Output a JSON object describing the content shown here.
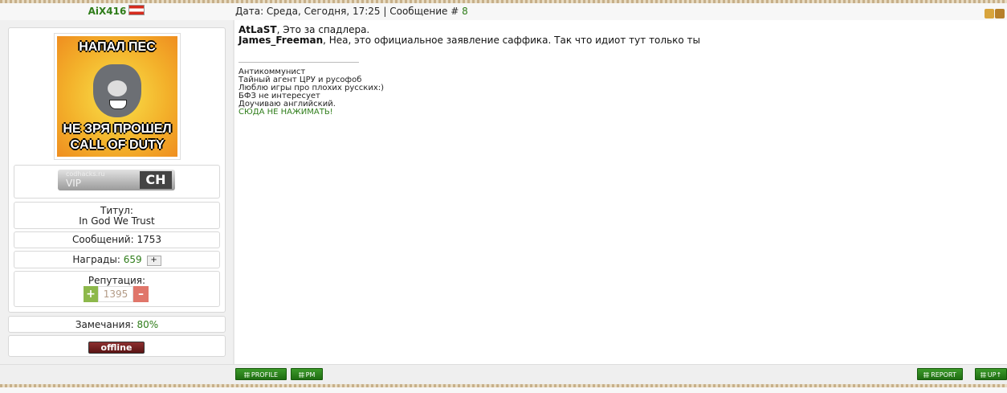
{
  "post": {
    "username": "AiX416",
    "header_date": "Дата: Среда, Сегодня, 17:25 | Сообщение # ",
    "message_number": "8"
  },
  "avatar": {
    "top_text": "НАПАЛ ПЕС",
    "bottom_text": "НЕ ЗРЯ ПРОШЕЛ CALL OF DUTY"
  },
  "vip_badge": {
    "site": "codhacks.ru",
    "label": "VIP",
    "logo": "CH"
  },
  "profile": {
    "title_label": "Титул:",
    "title_value": "In God We Trust",
    "posts_label": "Сообщений: 1753",
    "awards_label": "Награды:",
    "awards_value": "659",
    "reputation_label": "Репутация:",
    "reputation_value": "1395",
    "remarks_label": "Замечания:",
    "remarks_value": "80%",
    "status": "offline"
  },
  "message": {
    "line1_user": "AtLaST",
    "line1_text": ", Это за спадлера.",
    "line2_user": "James_Freeman",
    "line2_text": ", Неа, это официальное заявление саффика. Так что идиот тут только ты"
  },
  "signature": {
    "lines": [
      "Антикоммунист",
      "Тайный агент ЦРУ и русофоб",
      "Люблю игры про плохих русских:)",
      "БФЗ не интересует",
      "Доучиваю английский."
    ],
    "link": "СЮДА НЕ НАЖИМАТЬ!"
  },
  "footer": {
    "profile_button": "PROFILE",
    "pm_button": "PM",
    "report_button": "REPORT",
    "up_button": "UP"
  },
  "colors": {
    "accent_green": "#2f7d1a",
    "offline_red": "#8d2f2f"
  }
}
